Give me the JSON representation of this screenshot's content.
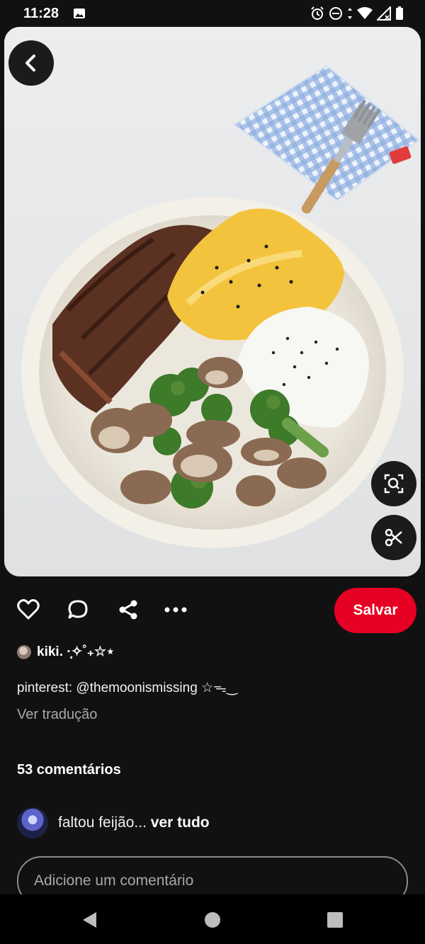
{
  "status_bar": {
    "time": "11:28",
    "icons": [
      "gallery-icon",
      "alarm-icon",
      "dnd-icon",
      "data-arrows-icon",
      "wifi-icon",
      "signal-icon",
      "battery-icon"
    ]
  },
  "pin": {
    "image_subject": "bowl of steak, omelette, rice with sesame, broccoli and mushrooms",
    "back_icon": "chevron-left-icon",
    "visual_search_icon": "lens-icon",
    "crop_icon": "scissors-icon"
  },
  "actions": {
    "like_icon": "heart-icon",
    "comment_icon": "comment-icon",
    "share_icon": "share-icon",
    "more_icon": "more-icon",
    "save_label": "Salvar",
    "save_color": "#e60023"
  },
  "author": {
    "name": "kiki. ·̩͙✧˚₊☆⋆"
  },
  "description": "pinterest: @themoonismissing ☆ᯓ‿",
  "translate_label": "Ver tradução",
  "comments": {
    "count_label": "53 comentários",
    "preview_text": "faltou feijão...",
    "see_all": "ver tudo",
    "input_placeholder": "Adicione um comentário"
  },
  "nav": {
    "back_icon": "nav-back-icon",
    "home_icon": "nav-home-icon",
    "recents_icon": "nav-recents-icon"
  }
}
